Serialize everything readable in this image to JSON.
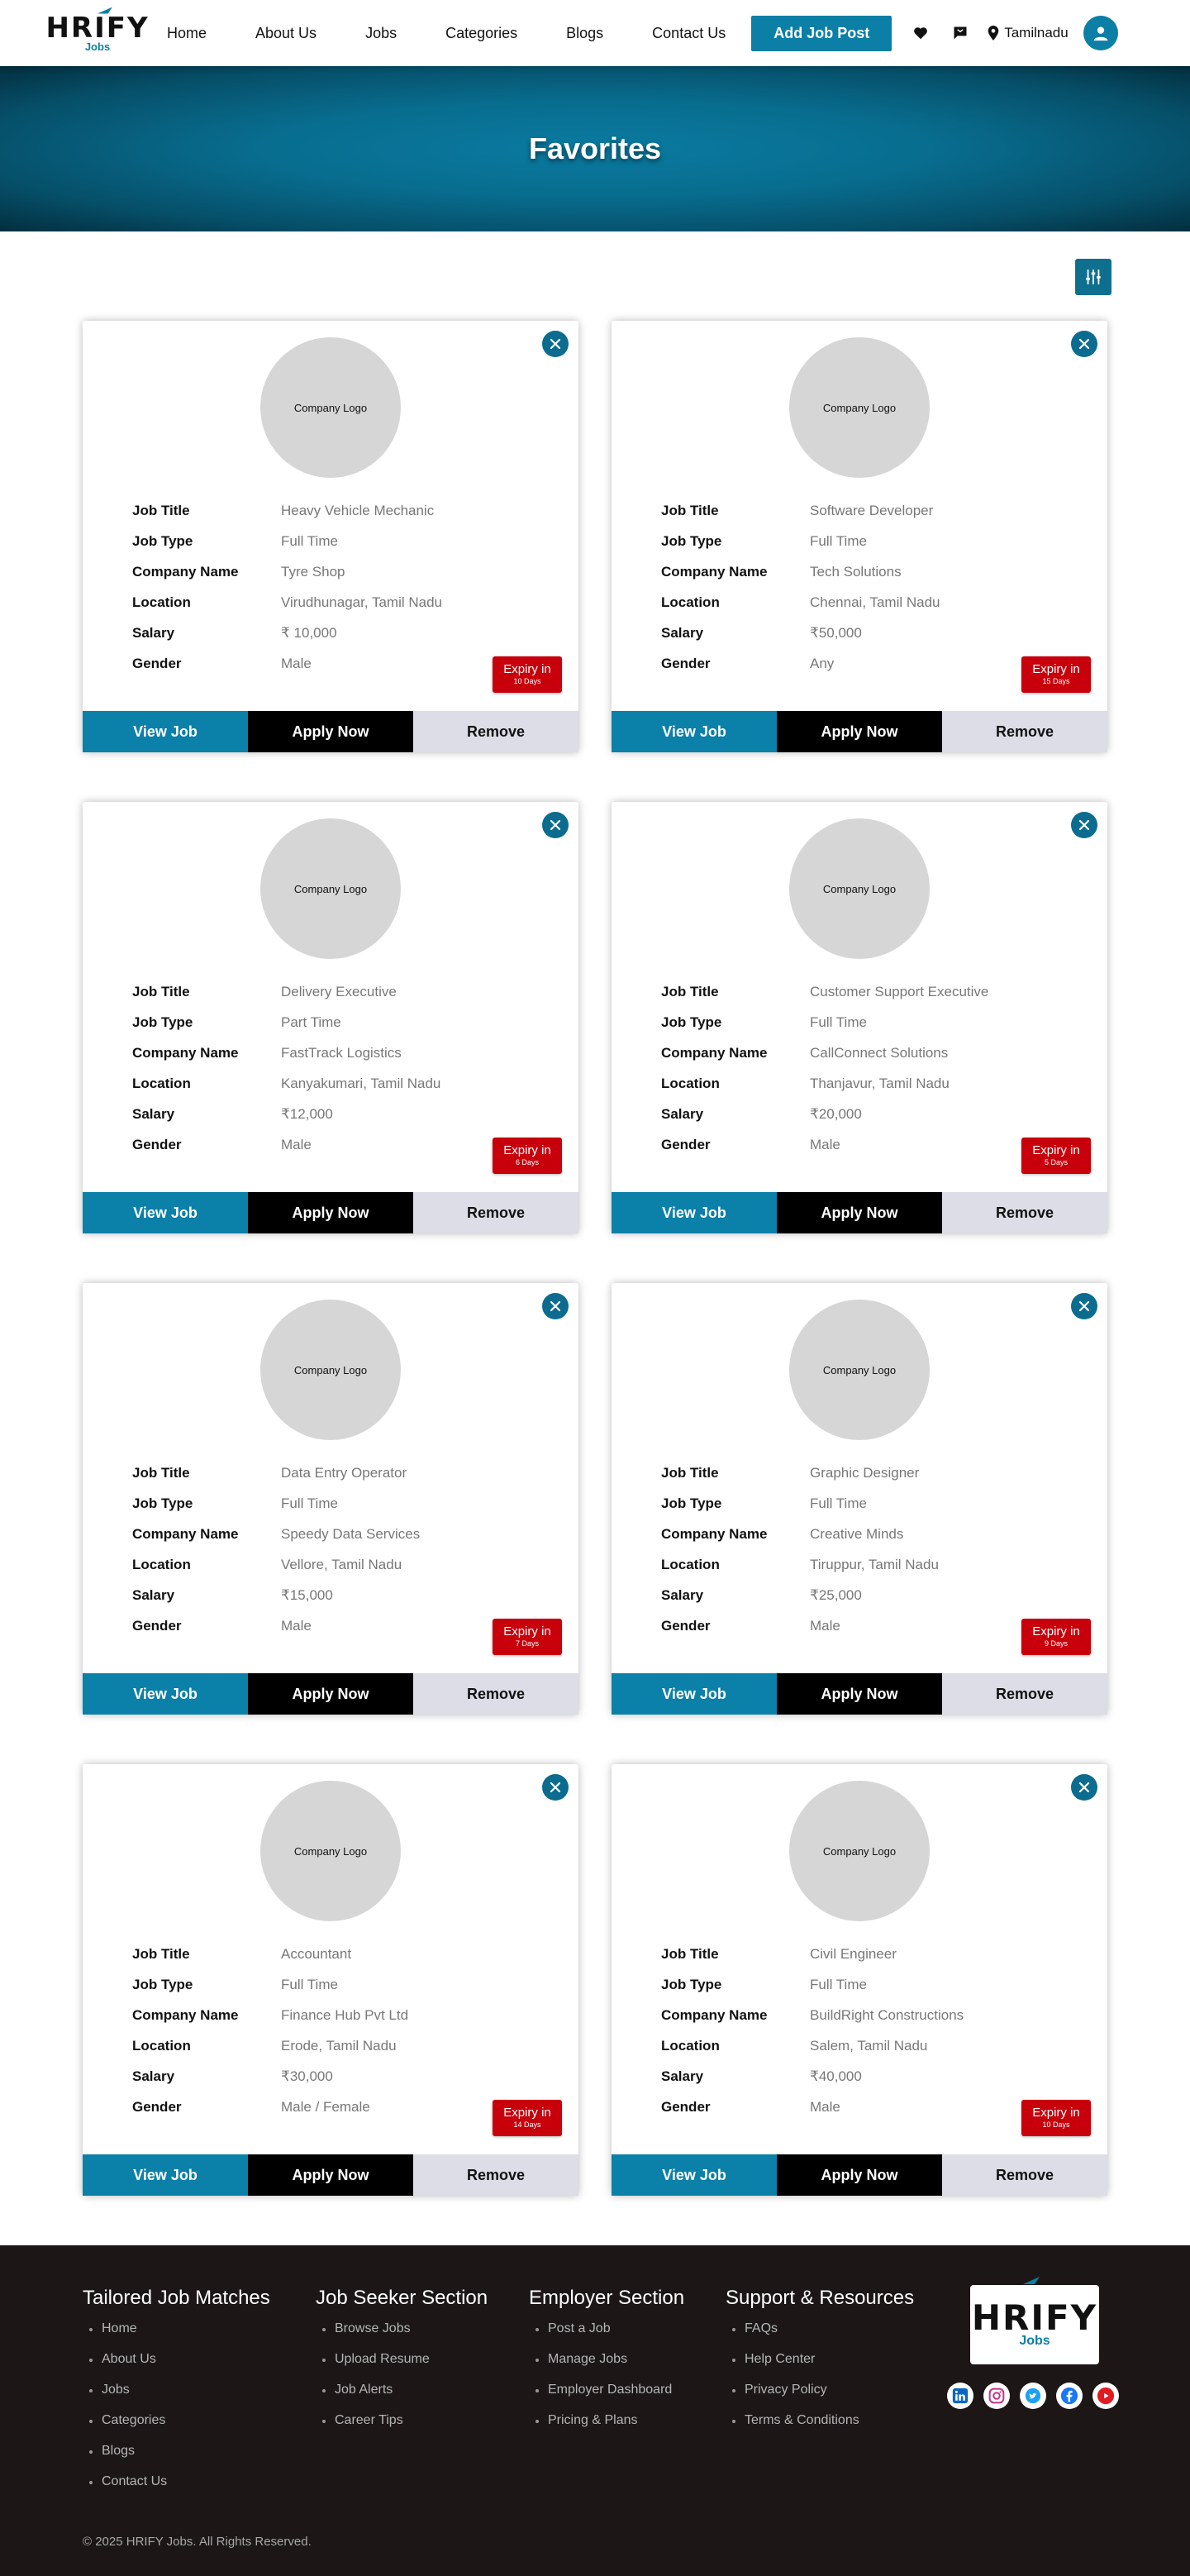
{
  "brand": {
    "logo_word": "HRIFY",
    "logo_sub": "Jobs",
    "accent": "#0b7fa5",
    "footer_bg": "#1c1617",
    "expiry_red": "#c7000b"
  },
  "nav": {
    "links": [
      "Home",
      "About Us",
      "Jobs",
      "Categories",
      "Blogs",
      "Contact Us"
    ],
    "add_job_label": "Add Job Post",
    "icons": [
      "heart-icon",
      "chat-flag-icon",
      "map-pin-icon",
      "user-icon"
    ],
    "location": "Tamilnadu"
  },
  "banner": {
    "title": "Favorites"
  },
  "card_labels": {
    "logo_placeholder": "Company Logo",
    "job_title": "Job Title",
    "job_type": "Job Type",
    "company_name": "Company Name",
    "location": "Location",
    "salary": "Salary",
    "gender": "Gender",
    "expiry_prefix": "Expiry in",
    "view": "View Job",
    "apply": "Apply Now",
    "remove": "Remove"
  },
  "jobs": [
    {
      "title": "Heavy Vehicle Mechanic",
      "type": "Full Time",
      "company": "Tyre Shop",
      "location": "Virudhunagar, Tamil Nadu",
      "salary": "₹ 10,000",
      "gender": "Male",
      "expiry": "10 Days"
    },
    {
      "title": "Software Developer",
      "type": "Full Time",
      "company": "Tech Solutions",
      "location": "Chennai, Tamil Nadu",
      "salary": "₹50,000",
      "gender": "Any",
      "expiry": "15 Days"
    },
    {
      "title": "Delivery Executive",
      "type": "Part Time",
      "company": "FastTrack Logistics",
      "location": "Kanyakumari, Tamil Nadu",
      "salary": "₹12,000",
      "gender": "Male",
      "expiry": "6 Days"
    },
    {
      "title": "Customer Support Executive",
      "type": "Full Time",
      "company": "CallConnect Solutions",
      "location": "Thanjavur, Tamil Nadu",
      "salary": "₹20,000",
      "gender": "Male",
      "expiry": "5 Days"
    },
    {
      "title": "Data Entry Operator",
      "type": "Full Time",
      "company": "Speedy Data Services",
      "location": "Vellore, Tamil Nadu",
      "salary": "₹15,000",
      "gender": "Male",
      "expiry": "7 Days"
    },
    {
      "title": "Graphic Designer",
      "type": "Full Time",
      "company": "Creative Minds",
      "location": "Tiruppur, Tamil Nadu",
      "salary": "₹25,000",
      "gender": "Male",
      "expiry": "9 Days"
    },
    {
      "title": "Accountant",
      "type": "Full Time",
      "company": "Finance Hub Pvt Ltd",
      "location": "Erode, Tamil Nadu",
      "salary": "₹30,000",
      "gender": "Male / Female",
      "expiry": "14 Days"
    },
    {
      "title": "Civil Engineer",
      "type": "Full Time",
      "company": "BuildRight Constructions",
      "location": "Salem, Tamil Nadu",
      "salary": "₹40,000",
      "gender": "Male",
      "expiry": "10 Days"
    }
  ],
  "footer": {
    "columns": [
      {
        "heading": "Tailored Job Matches",
        "items": [
          "Home",
          "About Us",
          "Jobs",
          "Categories",
          "Blogs",
          "Contact Us"
        ]
      },
      {
        "heading": "Job Seeker Section",
        "items": [
          "Browse Jobs",
          "Upload Resume",
          "Job Alerts",
          "Career Tips"
        ]
      },
      {
        "heading": "Employer Section",
        "items": [
          "Post a Job",
          "Manage Jobs",
          "Employer Dashboard",
          "Pricing & Plans"
        ]
      },
      {
        "heading": "Support & Resources",
        "items": [
          "FAQs",
          "Help Center",
          "Privacy Policy",
          "Terms & Conditions"
        ]
      }
    ],
    "socials": [
      "linkedin-icon",
      "instagram-icon",
      "twitter-icon",
      "facebook-icon",
      "youtube-icon"
    ],
    "copyright": "© 2025 HRIFY Jobs. All Rights Reserved."
  }
}
